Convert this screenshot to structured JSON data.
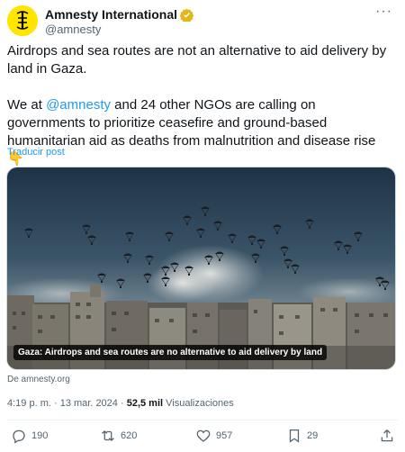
{
  "author": {
    "name": "Amnesty International",
    "handle": "@amnesty",
    "verified": true,
    "avatar_icon": "amnesty-candle-logo",
    "avatar_color": "#ffe500"
  },
  "tweet": {
    "line1": "Airdrops and sea routes are not an alternative to aid delivery by land in Gaza.",
    "line2_prefix": "We at ",
    "line2_mention": "@amnesty",
    "line2_suffix": " and 24 other NGOs are calling on governments to prioritize ceasefire and ground-based humanitarian aid as deaths from malnutrition and disease rise 👇",
    "translate_label": "Traducir post"
  },
  "media": {
    "caption": "Gaza: Airdrops and sea routes are no alternative to aid delivery by land"
  },
  "source": "De amnesty.org",
  "meta": {
    "time": "4:19 p. m.",
    "separator": " · ",
    "date": "13 mar. 2024",
    "views_count": "52,5 mil",
    "views_label": "Visualizaciones"
  },
  "actions": {
    "replies": "190",
    "reposts": "620",
    "likes": "957",
    "bookmarks": "29"
  },
  "colors": {
    "accent": "#1d9bf0",
    "secondary_text": "#536471",
    "primary_text": "#0f1419"
  }
}
